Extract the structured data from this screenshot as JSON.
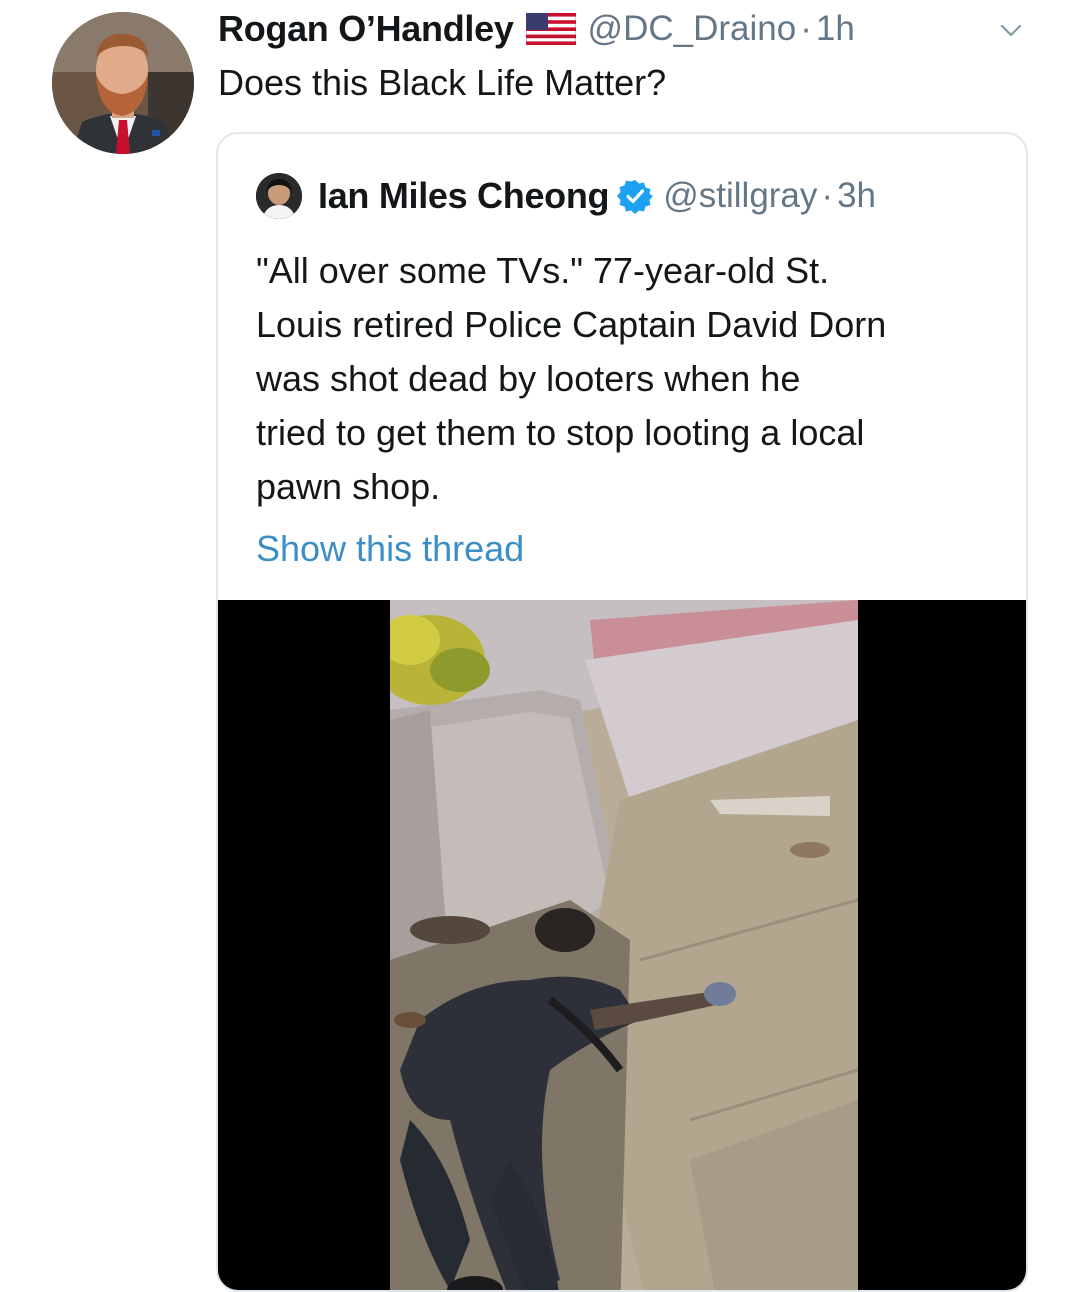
{
  "tweet": {
    "author_name": "Rogan O’Handley",
    "handle": "@DC_Draino",
    "separator": "·",
    "time": "1h",
    "text": "Does this Black Life Matter?",
    "flag_icon": "us-flag-icon",
    "menu_icon": "chevron-down-icon"
  },
  "quoted_tweet": {
    "author_name": "Ian Miles Cheong",
    "verified_icon": "verified-badge-icon",
    "handle": "@stillgray",
    "separator": "·",
    "time": "3h",
    "text": "\"All over some TVs.\" 77-year-old St.\nLouis retired Police Captain David Dorn\nwas shot dead by looters when he\ntried to get them to stop looting a local\npawn shop.",
    "show_thread_label": "Show this thread",
    "media": "video-thumbnail"
  },
  "colors": {
    "text_primary": "#14171a",
    "text_secondary": "#657786",
    "link": "#3b8fc4",
    "verified": "#1da1f2",
    "border": "#e1e8ed"
  }
}
